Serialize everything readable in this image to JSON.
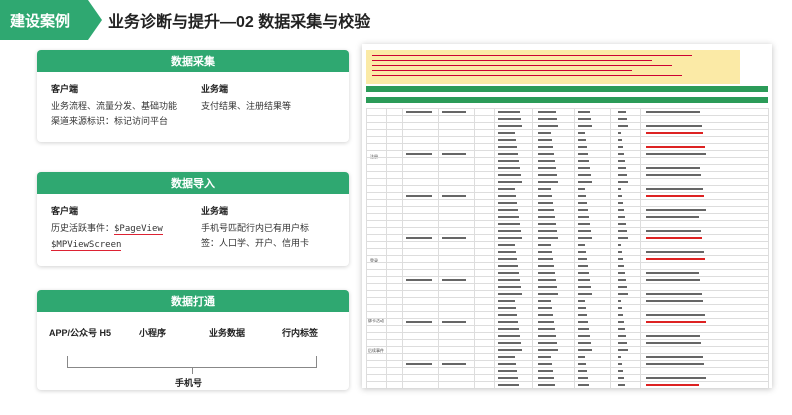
{
  "header": {
    "badge": "建设案例",
    "title": "业务诊断与提升—02 数据采集与校验"
  },
  "cards": {
    "collect": {
      "title": "数据采集",
      "client_title": "客户端",
      "client_lines": [
        "业务流程、流量分发、基础功能",
        "渠道来源标识：标记访问平台"
      ],
      "server_title": "业务端",
      "server_lines": [
        "支付结果、注册结果等"
      ]
    },
    "import": {
      "title": "数据导入",
      "client_title": "客户端",
      "client_line1_prefix": "历史活跃事件：",
      "client_line1_code": "$PageView",
      "client_line2_code": "$MPViewScreen",
      "server_title": "业务端",
      "server_lines": [
        "手机号匹配行内已有用户标",
        "签：人口学、开户、信用卡"
      ]
    },
    "connect": {
      "title": "数据打通",
      "sources": [
        "APP/公众号 H5",
        "小程序",
        "业务数据",
        "行内标签"
      ],
      "hub": "手机号"
    }
  },
  "screenshot": {
    "row_labels": [
      "注册",
      "登录",
      "绑卡活动",
      "后续事件"
    ]
  },
  "colors": {
    "accent": "#2fa871",
    "table_header": "#2b9b58",
    "notes_bg": "#fbeaa6"
  }
}
